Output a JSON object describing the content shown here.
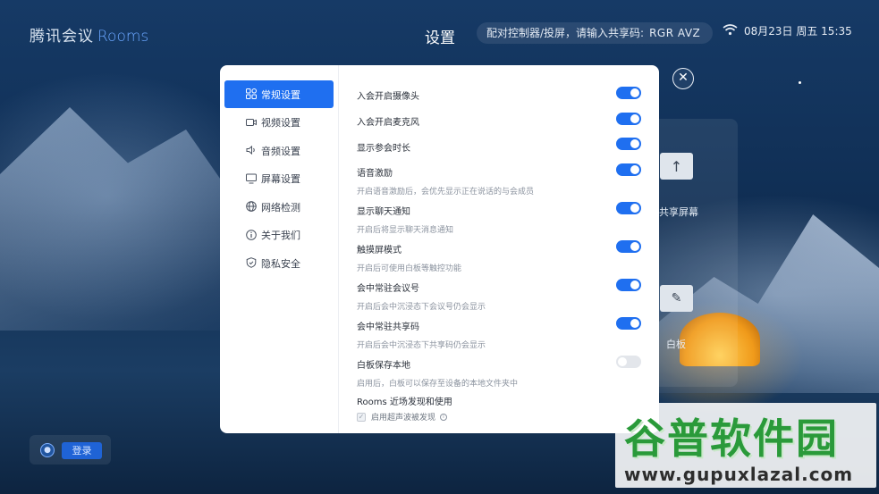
{
  "header": {
    "logo_main": "腾讯会议",
    "logo_rooms": "Rooms",
    "title": "设置",
    "pair_text": "配对控制器/投屏，请输入共享码:",
    "share_code": "RGR AVZ",
    "datetime": "08月23日 周五 15:35"
  },
  "background_panel": {
    "share_label": "共享屏幕",
    "whiteboard_label": "白板"
  },
  "login": {
    "label": "登录"
  },
  "sidebar": {
    "items": [
      {
        "label": "常规设置",
        "icon": "grid-icon",
        "active": true
      },
      {
        "label": "视频设置",
        "icon": "camera-icon",
        "active": false
      },
      {
        "label": "音频设置",
        "icon": "speaker-icon",
        "active": false
      },
      {
        "label": "屏幕设置",
        "icon": "monitor-icon",
        "active": false
      },
      {
        "label": "网络检测",
        "icon": "globe-icon",
        "active": false
      },
      {
        "label": "关于我们",
        "icon": "info-icon",
        "active": false
      },
      {
        "label": "隐私安全",
        "icon": "shield-icon",
        "active": false
      }
    ]
  },
  "settings": [
    {
      "title": "入会开启摄像头",
      "desc": "",
      "on": true
    },
    {
      "title": "入会开启麦克风",
      "desc": "",
      "on": true
    },
    {
      "title": "显示参会时长",
      "desc": "",
      "on": true
    },
    {
      "title": "语音激励",
      "desc": "开启语音激励后，会优先显示正在说话的与会成员",
      "on": true
    },
    {
      "title": "显示聊天通知",
      "desc": "开启后将显示聊天消息通知",
      "on": true
    },
    {
      "title": "触摸屏模式",
      "desc": "开启后可使用白板等触控功能",
      "on": true
    },
    {
      "title": "会中常驻会议号",
      "desc": "开启后会中沉浸态下会议号仍会显示",
      "on": true
    },
    {
      "title": "会中常驻共享码",
      "desc": "开启后会中沉浸态下共享码仍会显示",
      "on": true
    },
    {
      "title": "白板保存本地",
      "desc": "启用后，白板可以保存至设备的本地文件夹中",
      "on": false
    }
  ],
  "rooms_section": {
    "title": "Rooms 近场发现和使用",
    "checkbox_label": "启用超声波被发现",
    "checked": true
  },
  "watermark": {
    "brand": "谷普软件园",
    "url": "www.gupuxlazal.com"
  },
  "colors": {
    "accent": "#1f6ff0",
    "toggle_off": "#e3e6eb"
  }
}
